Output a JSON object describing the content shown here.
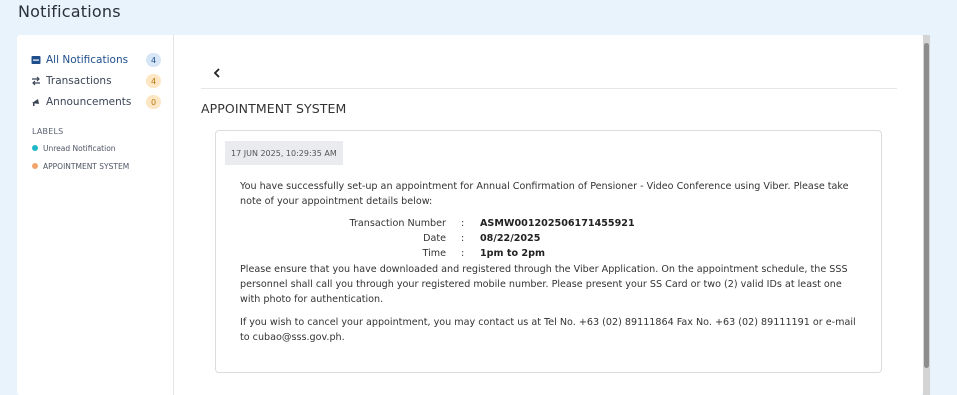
{
  "page": {
    "title": "Notifications"
  },
  "sidebar": {
    "items": [
      {
        "label": "All Notifications",
        "count": "4",
        "icon": "inbox-icon"
      },
      {
        "label": "Transactions",
        "count": "4",
        "icon": "transfer-icon"
      },
      {
        "label": "Announcements",
        "count": "0",
        "icon": "megaphone-icon"
      }
    ],
    "labels_title": "LABELS",
    "labels": [
      {
        "text": "Unread Notification",
        "color": "#1fb8c9"
      },
      {
        "text": "APPOINTMENT SYSTEM",
        "color": "#f2a56b"
      }
    ]
  },
  "main": {
    "section_title": "APPOINTMENT SYSTEM",
    "timestamp": "17 JUN 2025, 10:29:35 AM",
    "intro": "You have successfully set-up an appointment for Annual Confirmation of Pensioner - Video Conference using Viber. Please take note of your appointment details below:",
    "details": [
      {
        "label": "Transaction Number",
        "sep": ":",
        "value": "ASMW001202506171455921"
      },
      {
        "label": "Date",
        "sep": ":",
        "value": "08/22/2025"
      },
      {
        "label": "Time",
        "sep": ":",
        "value": "1pm to 2pm"
      }
    ],
    "paragraph2": "Please ensure that you have downloaded and registered through the Viber Application. On the appointment schedule, the SSS personnel shall call you through your registered mobile number. Please present your SS Card or two (2) valid IDs at least one with photo for authentication.",
    "paragraph3": "If you wish to cancel your appointment, you may contact us at Tel No. +63 (02) 89111864 Fax No. +63 (02) 89111191 or e-mail to cubao@sss.gov.ph."
  },
  "colors": {
    "accent": "#1f4e8c",
    "badge_blue_bg": "#d7e6f6",
    "badge_orange_bg": "#fde6c4",
    "background": "#e8f3fb"
  }
}
